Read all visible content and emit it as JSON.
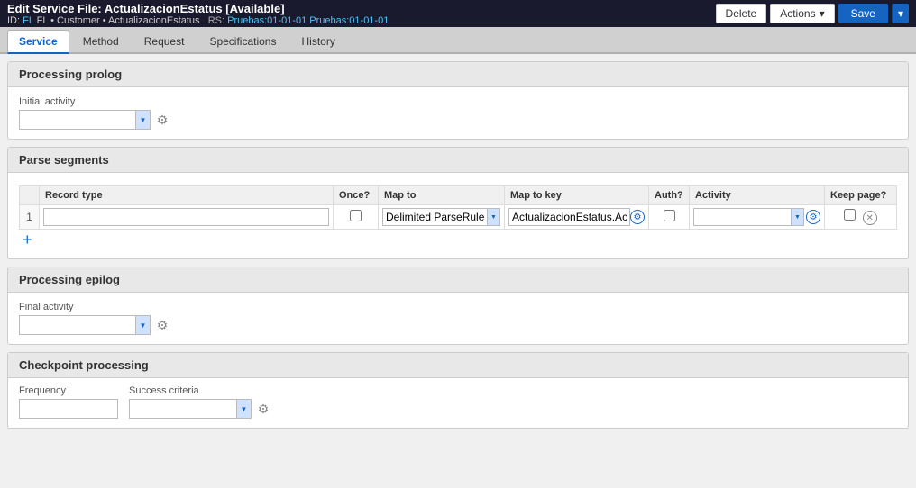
{
  "header": {
    "title": "Edit Service File: ActualizacionEstatus [Available]",
    "id_label": "ID:",
    "fl": "FL",
    "customer": "Customer",
    "service_name": "ActualizacionEstatus",
    "rs_label": "RS:",
    "rs_value": "Pruebas:01-01-01",
    "delete_label": "Delete",
    "actions_label": "Actions",
    "save_label": "Save"
  },
  "tabs": [
    {
      "id": "service",
      "label": "Service",
      "active": true
    },
    {
      "id": "method",
      "label": "Method",
      "active": false
    },
    {
      "id": "request",
      "label": "Request",
      "active": false
    },
    {
      "id": "specifications",
      "label": "Specifications",
      "active": false
    },
    {
      "id": "history",
      "label": "History",
      "active": false
    }
  ],
  "sections": {
    "processing_prolog": {
      "title": "Processing prolog",
      "initial_activity_label": "Initial activity",
      "initial_activity_value": ""
    },
    "parse_segments": {
      "title": "Parse segments",
      "columns": [
        "Record type",
        "Once?",
        "Map to",
        "Map to key",
        "Auth?",
        "Activity",
        "Keep page?"
      ],
      "rows": [
        {
          "num": 1,
          "record_type": "",
          "once": false,
          "map_to": "Delimited ParseRule",
          "map_to_key": "ActualizacionEstatus.Actu",
          "auth": false,
          "activity": "",
          "keep_page": false
        }
      ],
      "add_row_label": "+"
    },
    "processing_epilog": {
      "title": "Processing epilog",
      "final_activity_label": "Final activity",
      "final_activity_value": ""
    },
    "checkpoint_processing": {
      "title": "Checkpoint processing",
      "frequency_label": "Frequency",
      "frequency_value": "",
      "success_criteria_label": "Success criteria",
      "success_criteria_value": ""
    }
  }
}
